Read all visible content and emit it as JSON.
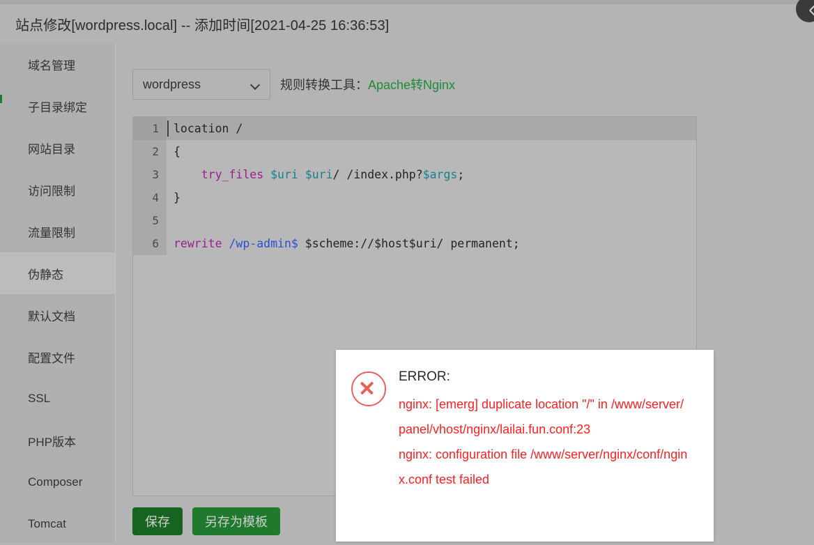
{
  "window": {
    "title": "站点修改[wordpress.local] -- 添加时间[2021-04-25 16:36:53]",
    "close_label": "✕"
  },
  "sidebar": {
    "items": [
      {
        "label": "域名管理",
        "active": false
      },
      {
        "label": "子目录绑定",
        "active": false
      },
      {
        "label": "网站目录",
        "active": false
      },
      {
        "label": "访问限制",
        "active": false
      },
      {
        "label": "流量限制",
        "active": false
      },
      {
        "label": "伪静态",
        "active": true
      },
      {
        "label": "默认文档",
        "active": false
      },
      {
        "label": "配置文件",
        "active": false
      },
      {
        "label": "SSL",
        "active": false
      },
      {
        "label": "PHP版本",
        "active": false
      },
      {
        "label": "Composer",
        "active": false
      },
      {
        "label": "Tomcat",
        "active": false
      }
    ]
  },
  "toolbar": {
    "template_selected": "wordpress",
    "template_options": [
      "wordpress"
    ],
    "converter_label": "规则转换工具：",
    "converter_link": "Apache转Nginx"
  },
  "editor": {
    "lines": [
      {
        "number": "1",
        "active": true,
        "tokens": [
          {
            "text": "location /",
            "type": "plain"
          }
        ]
      },
      {
        "number": "2",
        "active": false,
        "tokens": [
          {
            "text": "{",
            "type": "plain"
          }
        ]
      },
      {
        "number": "3",
        "active": false,
        "tokens": [
          {
            "text": "    ",
            "type": "plain"
          },
          {
            "text": "try_files",
            "type": "kw"
          },
          {
            "text": " ",
            "type": "plain"
          },
          {
            "text": "$uri",
            "type": "var"
          },
          {
            "text": " ",
            "type": "plain"
          },
          {
            "text": "$uri",
            "type": "var"
          },
          {
            "text": "/ /index.php?",
            "type": "plain"
          },
          {
            "text": "$args",
            "type": "var"
          },
          {
            "text": ";",
            "type": "plain"
          }
        ]
      },
      {
        "number": "4",
        "active": false,
        "tokens": [
          {
            "text": "}",
            "type": "plain"
          }
        ]
      },
      {
        "number": "5",
        "active": false,
        "tokens": [
          {
            "text": "",
            "type": "plain"
          }
        ]
      },
      {
        "number": "6",
        "active": false,
        "tokens": [
          {
            "text": "rewrite",
            "type": "kw"
          },
          {
            "text": " ",
            "type": "plain"
          },
          {
            "text": "/wp-admin$",
            "type": "path"
          },
          {
            "text": " $scheme://$host$uri/ permanent;",
            "type": "plain"
          }
        ]
      }
    ],
    "plain_text": "location /\n{\n    try_files $uri $uri/ /index.php?$args;\n}\n\nrewrite /wp-admin$ $scheme://$host$uri/ permanent;"
  },
  "error_dialog": {
    "icon": "error-circle-x-icon",
    "heading": "ERROR:",
    "messages": [
      "nginx: [emerg] duplicate location \"/\" in /www/server/panel/vhost/nginx/lailai.fun.conf:23",
      "nginx: configuration file /www/server/nginx/conf/nginx.conf test failed"
    ]
  },
  "footer": {
    "save_label": "保存",
    "save_as_template_label": "另存为模板"
  },
  "colors": {
    "window_bg": "#b4b4b4",
    "sidebar_bg": "#b0b0b0",
    "sidebar_active_bg": "#bcbcbc",
    "accent_green": "#1d8b35",
    "button_save_green": "#16641f",
    "button_template_green": "#1f7a2e",
    "error_red": "#fb2020",
    "editor_bg": "#b8b8b8",
    "gutter_bg": "#a9a9a9",
    "keyword": "#9b1f8e",
    "variable": "#1a7f8e",
    "path": "#2a4fd4"
  }
}
